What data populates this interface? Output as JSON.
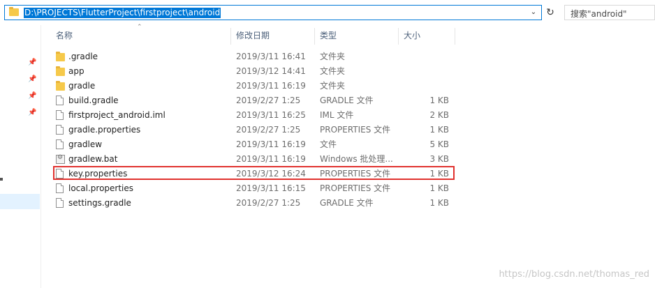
{
  "address_bar": {
    "path": "D:\\PROJECTS\\FlutterProject\\firstproject\\android"
  },
  "search": {
    "placeholder": "搜索\"android\""
  },
  "columns": {
    "name": "名称",
    "date": "修改日期",
    "type": "类型",
    "size": "大小"
  },
  "files": [
    {
      "name": ".gradle",
      "date": "2019/3/11 16:41",
      "type": "文件夹",
      "size": "",
      "icon": "folder-icon"
    },
    {
      "name": "app",
      "date": "2019/3/12 14:41",
      "type": "文件夹",
      "size": "",
      "icon": "folder-icon"
    },
    {
      "name": "gradle",
      "date": "2019/3/11 16:19",
      "type": "文件夹",
      "size": "",
      "icon": "folder-icon"
    },
    {
      "name": "build.gradle",
      "date": "2019/2/27 1:25",
      "type": "GRADLE 文件",
      "size": "1 KB",
      "icon": "file-icon"
    },
    {
      "name": "firstproject_android.iml",
      "date": "2019/3/11 16:25",
      "type": "IML 文件",
      "size": "2 KB",
      "icon": "file-icon"
    },
    {
      "name": "gradle.properties",
      "date": "2019/2/27 1:25",
      "type": "PROPERTIES 文件",
      "size": "1 KB",
      "icon": "file-icon"
    },
    {
      "name": "gradlew",
      "date": "2019/3/11 16:19",
      "type": "文件",
      "size": "5 KB",
      "icon": "file-icon"
    },
    {
      "name": "gradlew.bat",
      "date": "2019/3/11 16:19",
      "type": "Windows 批处理...",
      "size": "3 KB",
      "icon": "batch-file-icon"
    },
    {
      "name": "key.properties",
      "date": "2019/3/12 16:24",
      "type": "PROPERTIES 文件",
      "size": "1 KB",
      "icon": "file-icon",
      "highlighted": true
    },
    {
      "name": "local.properties",
      "date": "2019/3/11 16:15",
      "type": "PROPERTIES 文件",
      "size": "1 KB",
      "icon": "file-icon"
    },
    {
      "name": "settings.gradle",
      "date": "2019/2/27 1:25",
      "type": "GRADLE 文件",
      "size": "1 KB",
      "icon": "file-icon"
    }
  ],
  "watermark": "https://blog.csdn.net/thomas_red",
  "colors": {
    "selection": "#0078d7",
    "highlight_box": "#e0312e"
  }
}
